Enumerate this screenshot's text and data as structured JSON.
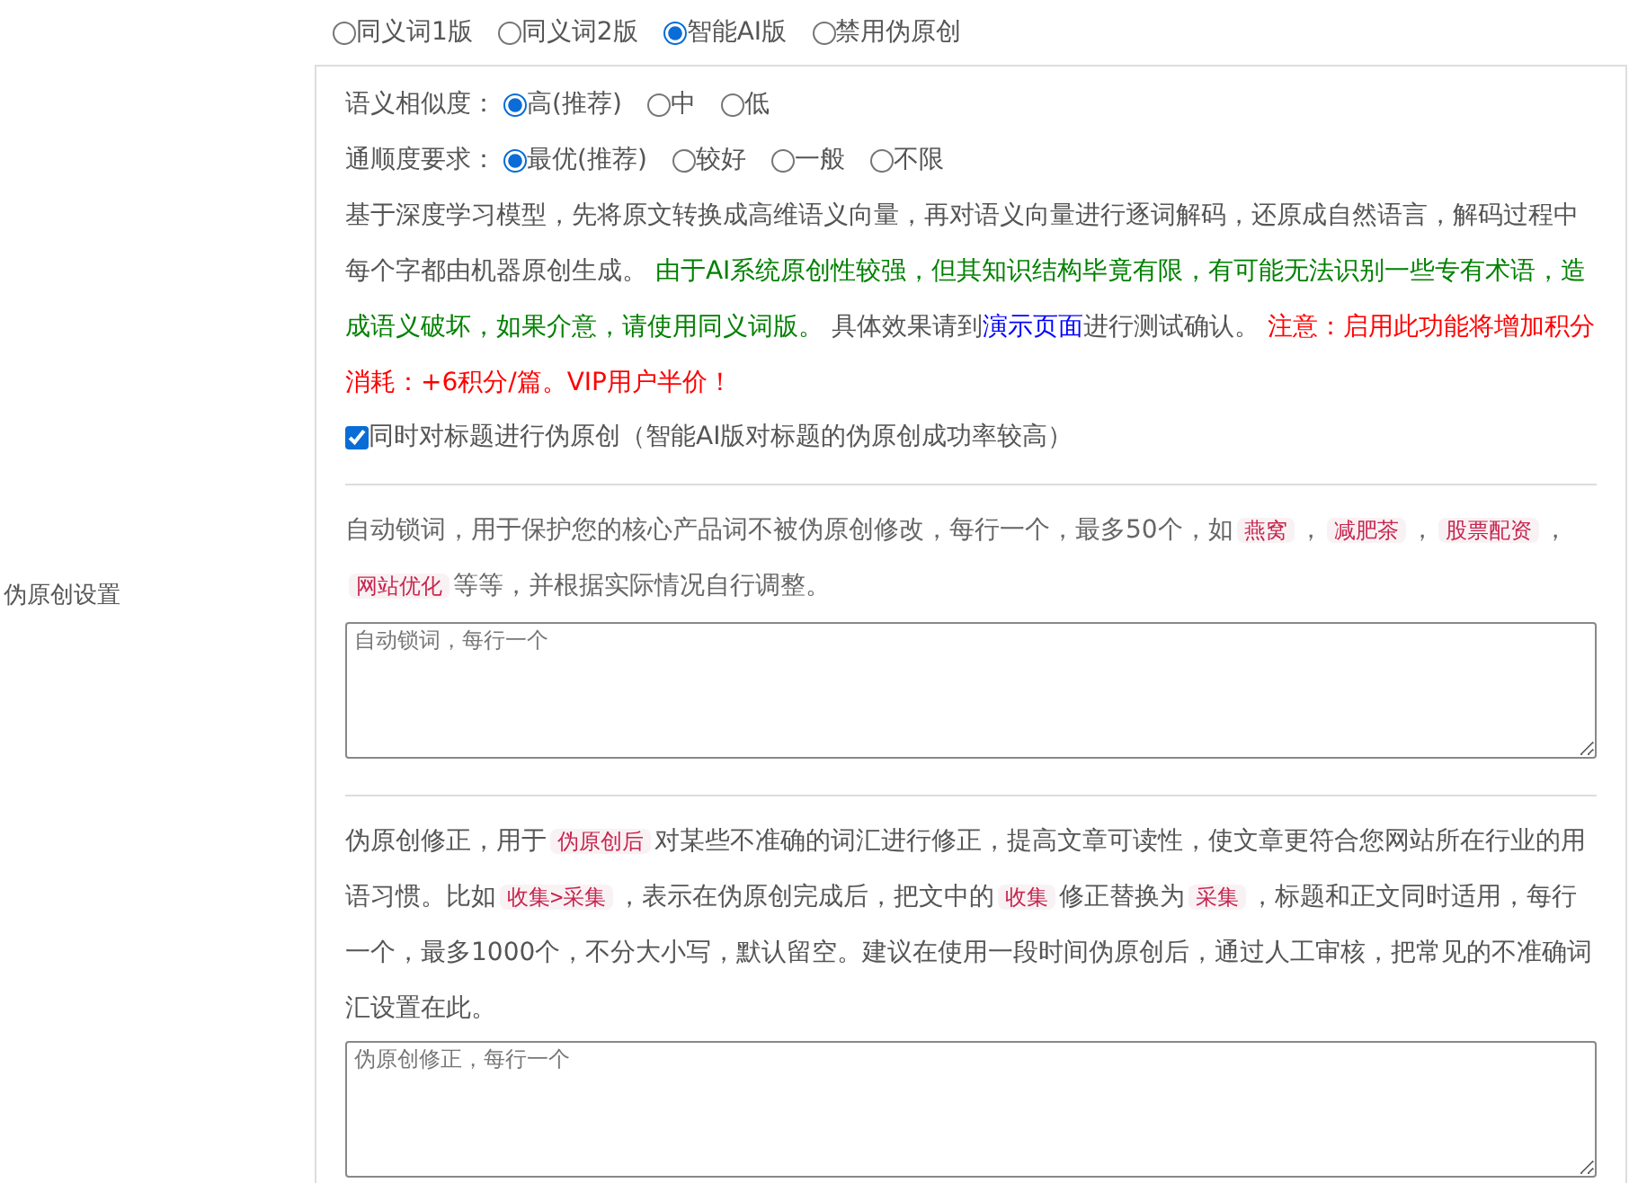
{
  "mode_options": [
    {
      "label": "同义词1版",
      "selected": false
    },
    {
      "label": "同义词2版",
      "selected": false
    },
    {
      "label": "智能AI版",
      "selected": true
    },
    {
      "label": "禁用伪原创",
      "selected": false
    }
  ],
  "similarity": {
    "label": "语义相似度：",
    "options": [
      {
        "label": "高(推荐)",
        "selected": true
      },
      {
        "label": "中",
        "selected": false
      },
      {
        "label": "低",
        "selected": false
      }
    ]
  },
  "fluency": {
    "label": "通顺度要求：",
    "options": [
      {
        "label": "最优(推荐)",
        "selected": true
      },
      {
        "label": "较好",
        "selected": false
      },
      {
        "label": "一般",
        "selected": false
      },
      {
        "label": "不限",
        "selected": false
      }
    ]
  },
  "ai_description": [
    {
      "kind": "plain",
      "text": "基于深度学习模型，先将原文转换成高维语义向量，再对语义向量进行逐词解码，还原成自然语言，解码过程中每个字都由机器原创生成。 "
    },
    {
      "kind": "green",
      "text": "由于AI系统原创性较强，但其知识结构毕竟有限，有可能无法识别一些专有术语，造成语义破坏，如果介意，请使用同义词版。"
    },
    {
      "kind": "plain",
      "text": " 具体效果请到"
    },
    {
      "kind": "link",
      "text": "演示页面"
    },
    {
      "kind": "plain",
      "text": "进行测试确认。 "
    },
    {
      "kind": "red",
      "text": "注意：启用此功能将增加积分消耗：+6积分/篇。VIP用户半价！"
    }
  ],
  "title_option": {
    "label": "同时对标题进行伪原创（智能AI版对标题的伪原创成功率较高）",
    "checked": true
  },
  "side_label": "伪原创设置",
  "lock_words": {
    "description": [
      {
        "kind": "plain",
        "text": "自动锁词，用于保护您的核心产品词不被伪原创修改，每行一个，最多50个，如"
      },
      {
        "kind": "tag",
        "text": "燕窝"
      },
      {
        "kind": "plain",
        "text": "，"
      },
      {
        "kind": "tag",
        "text": "减肥茶"
      },
      {
        "kind": "plain",
        "text": "，"
      },
      {
        "kind": "tag",
        "text": "股票配资"
      },
      {
        "kind": "plain",
        "text": "，"
      },
      {
        "kind": "tag",
        "text": "网站优化"
      },
      {
        "kind": "plain",
        "text": "等等，并根据实际情况自行调整。"
      }
    ],
    "placeholder": "自动锁词，每行一个"
  },
  "corrections": {
    "description": [
      {
        "kind": "plain",
        "text": "伪原创修正，用于"
      },
      {
        "kind": "tag",
        "text": "伪原创后"
      },
      {
        "kind": "plain",
        "text": "对某些不准确的词汇进行修正，提高文章可读性，使文章更符合您网站所在行业的用语习惯。比如"
      },
      {
        "kind": "tag",
        "text": "收集>采集"
      },
      {
        "kind": "plain",
        "text": "，表示在伪原创完成后，把文中的"
      },
      {
        "kind": "tag",
        "text": "收集"
      },
      {
        "kind": "plain",
        "text": "修正替换为"
      },
      {
        "kind": "tag",
        "text": "采集"
      },
      {
        "kind": "plain",
        "text": "，标题和正文同时适用，每行一个，最多1000个，不分大小写，默认留空。建议在使用一段时间伪原创后，通过人工审核，把常见的不准确词汇设置在此。"
      }
    ],
    "placeholder": "伪原创修正，每行一个"
  }
}
